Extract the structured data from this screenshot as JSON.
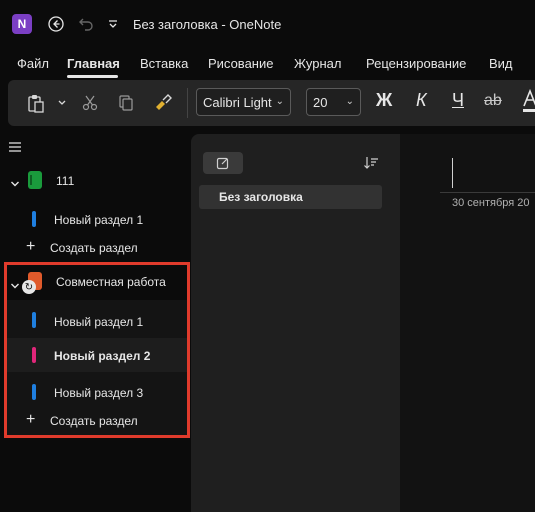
{
  "titlebar": {
    "logo_letter": "N",
    "title": "Без заголовка  -  OneNote"
  },
  "menu": {
    "tabs": [
      "Файл",
      "Главная",
      "Вставка",
      "Рисование",
      "Журнал",
      "Рецензирование",
      "Вид"
    ],
    "active_tab": "Главная"
  },
  "ribbon": {
    "font_name": "Calibri Light",
    "font_size": "20",
    "bold": "Ж",
    "italic": "К",
    "underline": "Ч",
    "strike": "ab"
  },
  "notebooks": [
    {
      "name": "111",
      "color": "#1a9b3c",
      "sections": [
        {
          "label": "Новый раздел 1",
          "color": "#1f7fe0",
          "selected": false
        }
      ],
      "add_section": "Создать раздел"
    },
    {
      "name": "Совместная работа",
      "color": "#e05a2b",
      "sections": [
        {
          "label": "Новый раздел 1",
          "color": "#1f7fe0",
          "selected": false
        },
        {
          "label": "Новый раздел  2",
          "color": "#e0267a",
          "selected": true
        },
        {
          "label": "Новый раздел  3",
          "color": "#1f7fe0",
          "selected": false
        }
      ],
      "add_section": "Создать раздел"
    }
  ],
  "pages": {
    "items": [
      "Без заголовка"
    ]
  },
  "page": {
    "date": "30 сентября 20"
  },
  "colors": {
    "highlight": "#e03b2c",
    "accent_purple": "#7b3fc4"
  }
}
